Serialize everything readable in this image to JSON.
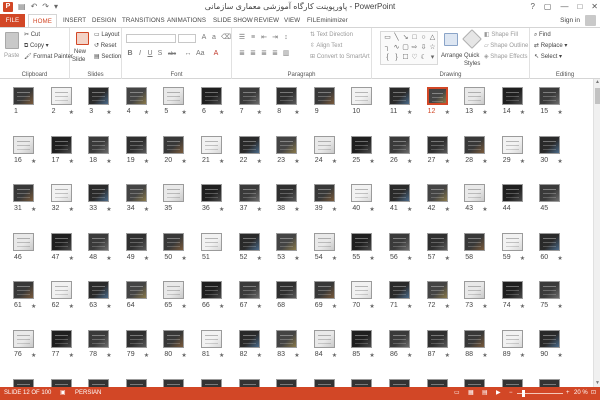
{
  "window": {
    "title": "پاورپوینت کارگاه آموزشی معماری سازمانی - PowerPoint",
    "controls": [
      "?",
      "▢",
      "—",
      "□",
      "✕"
    ]
  },
  "quick_access": {
    "app_logo": "P",
    "save_icon": "save-icon",
    "undo": "↶",
    "redo": "↷"
  },
  "ribbon_tabs": [
    "FILE",
    "HOME",
    "INSERT",
    "DESIGN",
    "TRANSITIONS",
    "ANIMATIONS",
    "SLIDE SHOW",
    "REVIEW",
    "VIEW",
    "FILEminimizer"
  ],
  "active_tab": "HOME",
  "account": {
    "sign_in": "Sign in"
  },
  "ribbon": {
    "clipboard": {
      "paste": "Paste",
      "cut": "Cut",
      "copy": "Copy",
      "format_painter": "Format Painter",
      "label": "Clipboard"
    },
    "slides": {
      "new_slide": "New",
      "new_slide_2": "Slide",
      "layout": "Layout",
      "reset": "Reset",
      "section": "Section",
      "label": "Slides"
    },
    "font": {
      "label": "Font",
      "bold": "B",
      "italic": "I",
      "underline": "U",
      "shadow": "S",
      "strike": "abc",
      "font_color": "A"
    },
    "paragraph": {
      "text_direction": "Text Direction",
      "align_text": "Align Text",
      "convert_smartart": "Convert to SmartArt",
      "label": "Paragraph"
    },
    "drawing": {
      "arrange": "Arrange",
      "quick_styles": "Quick",
      "quick_styles_2": "Styles",
      "shape_fill": "Shape Fill",
      "shape_outline": "Shape Outline",
      "shape_effects": "Shape Effects",
      "label": "Drawing"
    },
    "editing": {
      "find": "Find",
      "replace": "Replace",
      "select": "Select",
      "label": "Editing"
    }
  },
  "slide_sorter": {
    "selected_slide": 12,
    "rows": [
      {
        "numbers": [
          "1",
          "2",
          "3",
          "4",
          "5",
          "6",
          "7",
          "8",
          "9",
          "10",
          "11",
          "12",
          "13",
          "14",
          "15"
        ]
      },
      {
        "numbers": [
          "16",
          "17",
          "18",
          "19",
          "20",
          "21",
          "22",
          "23",
          "24",
          "25",
          "26",
          "27",
          "28",
          "29",
          "30"
        ]
      },
      {
        "numbers": [
          "31",
          "32",
          "33",
          "34",
          "35",
          "36",
          "37",
          "38",
          "39",
          "40",
          "41",
          "42",
          "43",
          "44",
          "45"
        ]
      },
      {
        "numbers": [
          "46",
          "47",
          "48",
          "49",
          "50",
          "51",
          "52",
          "53",
          "54",
          "55",
          "56",
          "57",
          "58",
          "59",
          "60"
        ]
      },
      {
        "numbers": [
          "61",
          "62",
          "63",
          "64",
          "65",
          "66",
          "67",
          "68",
          "69",
          "70",
          "71",
          "72",
          "73",
          "74",
          "75"
        ]
      },
      {
        "numbers": [
          "76",
          "77",
          "78",
          "79",
          "80",
          "81",
          "82",
          "83",
          "84",
          "85",
          "86",
          "87",
          "88",
          "89",
          "90"
        ]
      }
    ],
    "animated_slides": [
      "2",
      "3",
      "4",
      "5",
      "6",
      "7",
      "8",
      "11",
      "12",
      "13",
      "14",
      "15",
      "16",
      "17",
      "18",
      "19",
      "20",
      "21",
      "22",
      "23",
      "24",
      "25",
      "26",
      "27",
      "28",
      "29",
      "30",
      "31",
      "32",
      "33",
      "34",
      "36",
      "37",
      "38",
      "39",
      "40",
      "41",
      "42",
      "43",
      "47",
      "48",
      "49",
      "50",
      "52",
      "53",
      "54",
      "55",
      "56",
      "57",
      "59",
      "60",
      "61",
      "62",
      "63",
      "65",
      "66",
      "67",
      "69",
      "70",
      "71",
      "72",
      "73",
      "74",
      "75",
      "76",
      "77",
      "78",
      "79",
      "80",
      "81",
      "82",
      "83",
      "84",
      "85",
      "86",
      "87",
      "88",
      "89",
      "90"
    ]
  },
  "status_bar": {
    "slide_position": "SLIDE 12 OF 100",
    "language": "PERSIAN",
    "zoom": "20 %"
  },
  "colors": {
    "accent": "#d24726",
    "selection": "#d24726",
    "status_bar": "#d24726"
  }
}
